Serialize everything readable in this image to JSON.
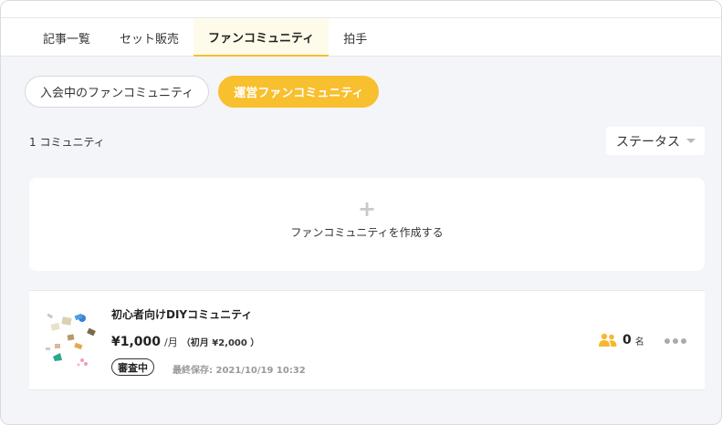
{
  "tabs": [
    {
      "label": "記事一覧",
      "active": false
    },
    {
      "label": "セット販売",
      "active": false
    },
    {
      "label": "ファンコミュニティ",
      "active": true
    },
    {
      "label": "拍手",
      "active": false
    }
  ],
  "filters": {
    "joined": "入会中のファンコミュニティ",
    "managed": "運営ファンコミュニティ"
  },
  "summary": {
    "count_text": "1 コミュニティ"
  },
  "status_select": {
    "selected": "ステータス"
  },
  "create_card": {
    "plus": "+",
    "label": "ファンコミュニティを作成する"
  },
  "community": {
    "title": "初心者向けDIYコミュニティ",
    "price": "¥1,000",
    "per": "/月",
    "initial": "（初月 ¥2,000 ）",
    "status_badge": "審査中",
    "last_saved": "最終保存: 2021/10/19 10:32",
    "member_count": "0",
    "member_unit": "名"
  },
  "colors": {
    "accent": "#f8bf2e",
    "background": "#f4f5f8",
    "tab_active_bg": "#fffbea"
  },
  "icons": {
    "members": "people-icon",
    "more": "more-horizontal-icon",
    "caret": "caret-down-icon"
  }
}
